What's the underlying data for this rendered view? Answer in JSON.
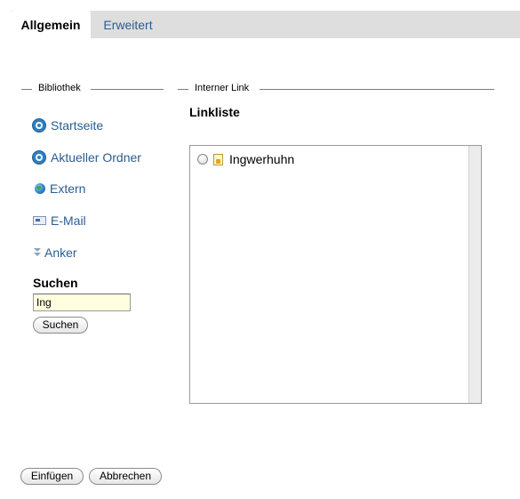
{
  "tabs": [
    {
      "label": "Allgemein",
      "active": true
    },
    {
      "label": "Erweitert",
      "active": false
    }
  ],
  "bibliothek": {
    "legend": "Bibliothek",
    "items": [
      {
        "label": "Startseite",
        "icon": "node-icon"
      },
      {
        "label": "Aktueller Ordner",
        "icon": "node-icon"
      },
      {
        "label": "Extern",
        "icon": "globe-icon"
      },
      {
        "label": "E-Mail",
        "icon": "mail-icon"
      },
      {
        "label": "Anker",
        "icon": "anchor-icon"
      }
    ],
    "search": {
      "label": "Suchen",
      "value": "Ing",
      "button": "Suchen"
    }
  },
  "interner_link": {
    "legend": "Interner Link",
    "list_title": "Linkliste",
    "items": [
      {
        "label": "Ingwerhuhn",
        "selected": false
      }
    ]
  },
  "footer": {
    "insert_button": "Einfügen",
    "cancel_button": "Abbrechen"
  },
  "colors": {
    "link": "#2a5e8f",
    "rule": "#4f88b4",
    "tabbar": "#dedede",
    "input_bg": "#ffffe0"
  }
}
